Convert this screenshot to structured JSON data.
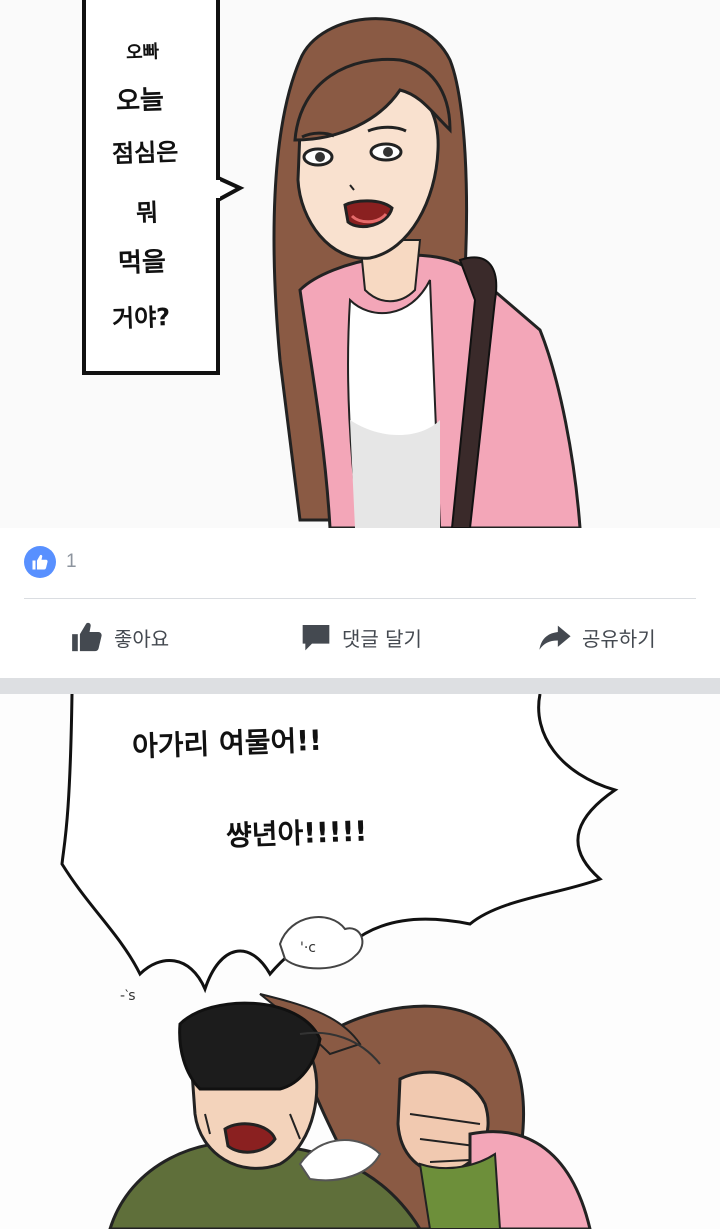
{
  "post1": {
    "speech_bubble": [
      "오빠",
      "오늘",
      "점심은",
      "뭐",
      "먹을",
      "거야?"
    ],
    "reactions": {
      "icon": "thumbs-up-icon",
      "count": "1"
    },
    "actions": {
      "like_label": "좋아요",
      "comment_label": "댓글 달기",
      "share_label": "공유하기"
    }
  },
  "post2": {
    "shout_lines": [
      "아가리 여물어!!",
      "썅년아!!!!!"
    ]
  },
  "colors": {
    "accent_like": "#5890ff",
    "action_text": "#444950",
    "separator": "#dddfe2",
    "jacket_pink": "#f3a6b8"
  }
}
